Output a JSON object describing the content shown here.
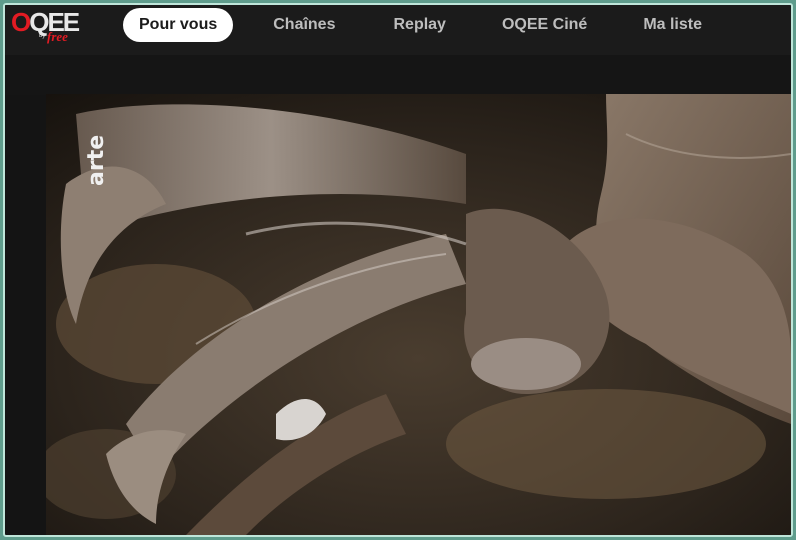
{
  "brand": {
    "logo_main_red": "O",
    "logo_main_white": "QEE",
    "logo_by": "by",
    "logo_free": "free",
    "accent": "#e31b23"
  },
  "nav": {
    "items": [
      {
        "label": "Pour vous",
        "active": true
      },
      {
        "label": "Chaînes",
        "active": false
      },
      {
        "label": "Replay",
        "active": false
      },
      {
        "label": "OQEE Ciné",
        "active": false
      },
      {
        "label": "Ma liste",
        "active": false
      }
    ]
  },
  "player": {
    "channel_logo": "arte"
  }
}
